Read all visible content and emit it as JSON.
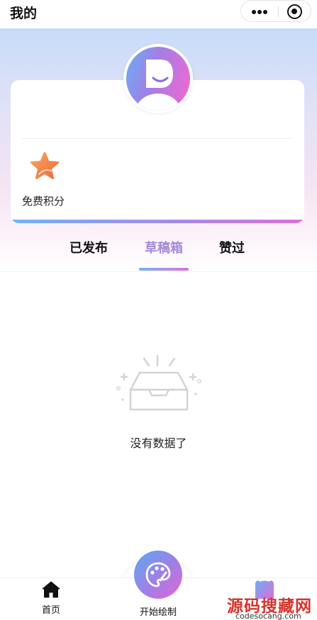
{
  "header": {
    "title": "我的",
    "more_icon": "more-dots-icon",
    "capsule_icon": "target-icon"
  },
  "profile": {
    "avatar_icon": "avatar-smile-icon",
    "points": {
      "icon": "star-icon",
      "label": "免费积分"
    }
  },
  "tabs": [
    {
      "label": "已发布",
      "active": false
    },
    {
      "label": "草稿箱",
      "active": true
    },
    {
      "label": "赞过",
      "active": false
    }
  ],
  "empty": {
    "icon": "empty-box-icon",
    "text": "没有数据了"
  },
  "tabbar": {
    "home": {
      "label": "首页",
      "icon": "home-icon"
    },
    "draw": {
      "label": "开始绘制",
      "icon": "palette-icon"
    },
    "mine": {
      "icon": "mine-icon"
    }
  },
  "watermark": {
    "main": "源码搜藏网",
    "sub": "codesocang.com"
  },
  "colors": {
    "accent": "#a48ad7",
    "gradient_start": "#6fb3f3",
    "gradient_end": "#da6fd8",
    "watermark": "#d2352d"
  }
}
